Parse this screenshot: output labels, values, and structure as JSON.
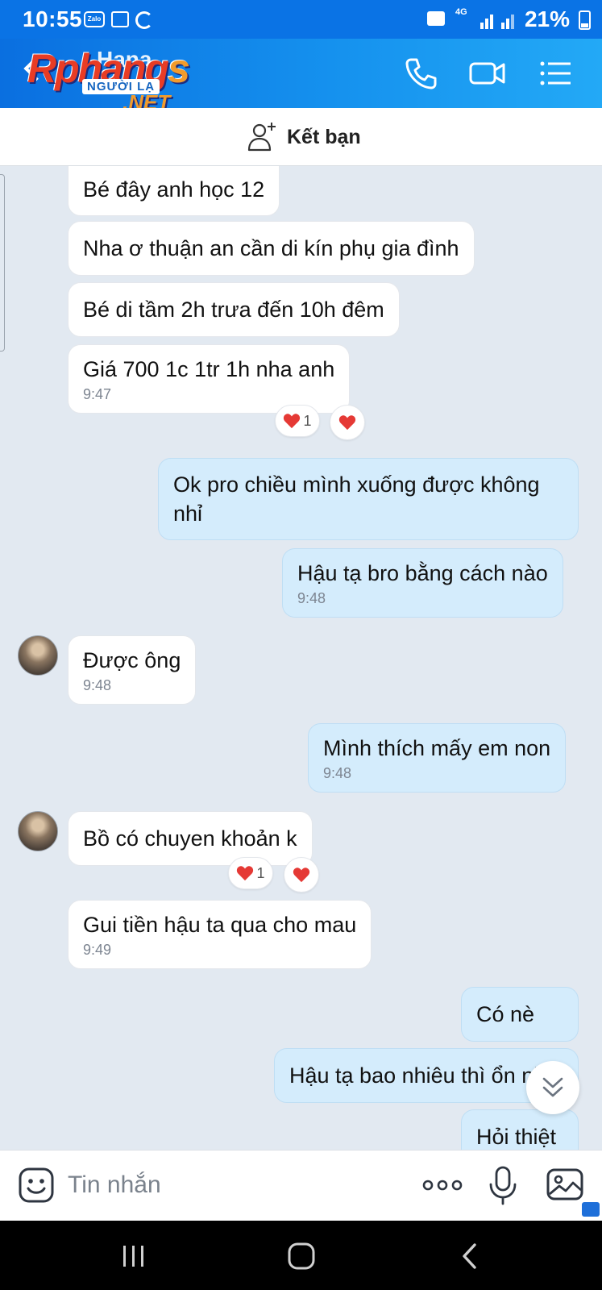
{
  "status_bar": {
    "time": "10:55",
    "zalo_badge": "Zalo",
    "network": "4G",
    "battery": "21%",
    "icons": [
      "zalo-icon",
      "gallery-icon",
      "sync-icon",
      "folder-icon",
      "signal-icon",
      "battery-icon"
    ]
  },
  "header": {
    "contact_name": "Hana",
    "watermark_line1_main": "Rphang",
    "watermark_line1_end": "s",
    "watermark_line2": "NGƯỜI LẠ",
    "watermark_line3": ".NET",
    "actions": [
      "phone-icon",
      "video-call-icon",
      "menu-icon"
    ]
  },
  "friend_bar": {
    "label": "Kết bạn",
    "icon": "add-friend-icon"
  },
  "messages": [
    {
      "side": "in",
      "text": "Bé đây anh học 12",
      "time": ""
    },
    {
      "side": "in",
      "text": "Nha ơ thuận an cần di kín phụ gia đình",
      "time": ""
    },
    {
      "side": "in",
      "text": "Bé di tầm 2h trưa đến 10h đêm",
      "time": ""
    },
    {
      "side": "in",
      "text": "Giá 700 1c  1tr 1h nha anh",
      "time": "9:47",
      "reaction_count": "1"
    },
    {
      "side": "out",
      "text_line1": "Ok pro chiều mình xuống được không",
      "text_line2": "nhỉ",
      "time": ""
    },
    {
      "side": "out",
      "text": "Hậu tạ bro bằng cách nào",
      "time": "9:48"
    },
    {
      "side": "in",
      "text": "Được ông",
      "time": "9:48"
    },
    {
      "side": "out",
      "text": "Mình thích mấy em non",
      "time": "9:48"
    },
    {
      "side": "in",
      "text": "Bồ có chuyen khoản k",
      "time": "",
      "reaction_count": "1"
    },
    {
      "side": "in",
      "text": "Gui tiền hậu ta qua cho mau",
      "time": "9:49"
    },
    {
      "side": "out",
      "text": "Có nè",
      "time": ""
    },
    {
      "side": "out",
      "text": "Hậu tạ bao nhiêu thì ổn nhỉ",
      "time": ""
    },
    {
      "side": "out",
      "text": "Hỏi thiệt",
      "time": ""
    }
  ],
  "input_bar": {
    "placeholder": "Tin nhắn",
    "icons": [
      "sticker-icon",
      "more-icon",
      "microphone-icon",
      "image-icon"
    ]
  },
  "colors": {
    "header": "#0a73e5",
    "incoming_bubble": "#ffffff",
    "outgoing_bubble": "#d4ecfc",
    "chat_background": "#e2e9f1",
    "reaction_heart": "#e53935"
  }
}
